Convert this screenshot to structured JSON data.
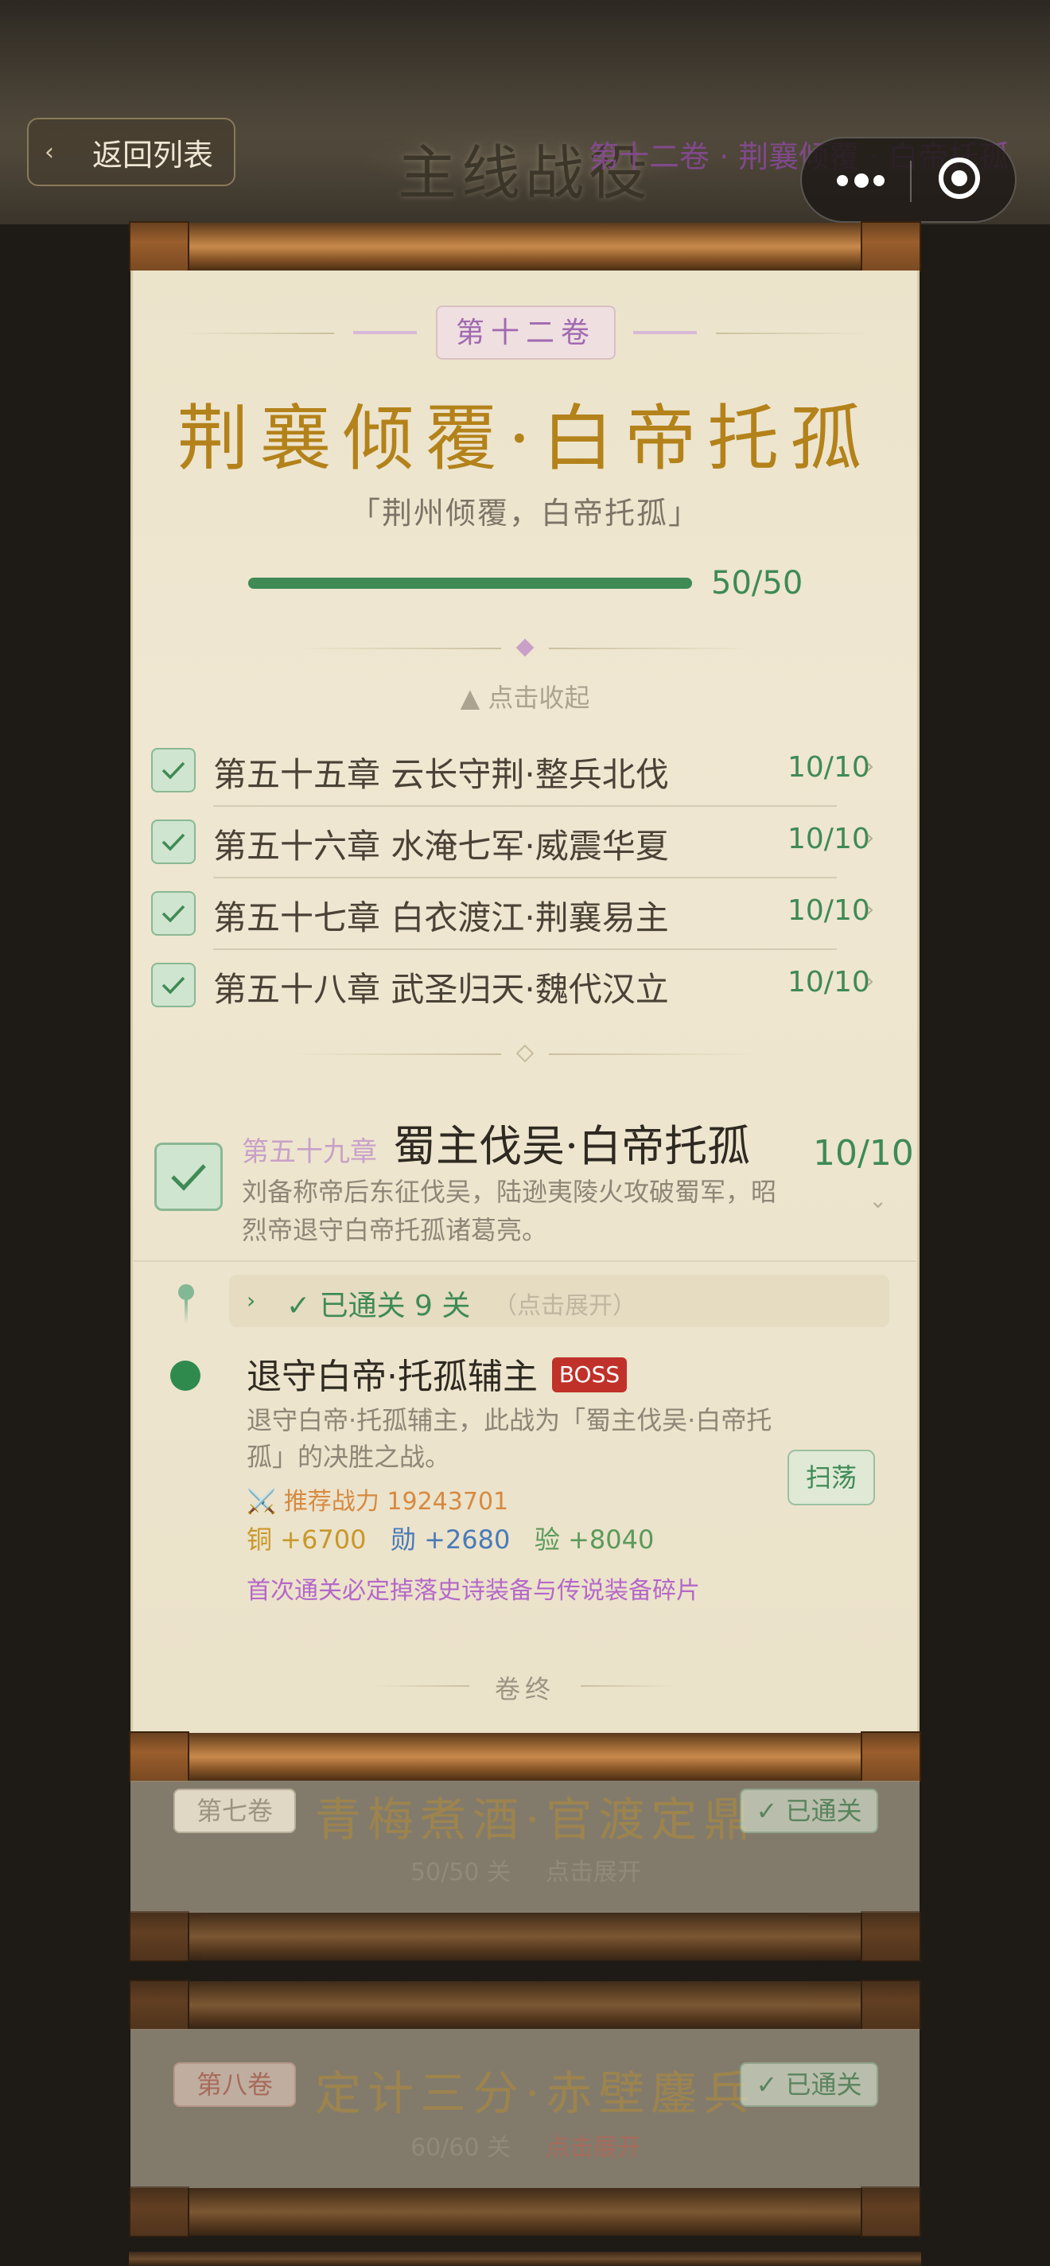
{
  "header": {
    "back_label": "返回列表",
    "back_icon": "chevron-left-icon",
    "title": "主线战役",
    "subtitle": "第十二卷 · 荆襄倾覆 · 白帝托孤"
  },
  "volume": {
    "tag": "第十二卷",
    "title": "荆襄倾覆·白帝托孤",
    "quote": "「荆州倾覆，白帝托孤」",
    "progress_text": "50/50",
    "progress_value": 1.0,
    "collapse_label": "▲ 点击收起"
  },
  "chapters": [
    {
      "name": "第五十五章 云长守荆·整兵北伐",
      "count": "10/10"
    },
    {
      "name": "第五十六章 水淹七军·威震华夏",
      "count": "10/10"
    },
    {
      "name": "第五十七章 白衣渡江·荆襄易主",
      "count": "10/10"
    },
    {
      "name": "第五十八章 武圣归天·魏代汉立",
      "count": "10/10"
    }
  ],
  "current_chapter": {
    "tag": "第五十九章",
    "name": "蜀主伐吴·白帝托孤",
    "count": "10/10",
    "desc": "刘备称帝后东征伐吴，陆逊夷陵火攻破蜀军，昭烈帝退守白帝托孤诸葛亮。",
    "cleared_text": "已通关 9 关",
    "cleared_hint": "（点击展开）"
  },
  "stage": {
    "name": "退守白帝·托孤辅主",
    "badge": "BOSS",
    "desc": "退守白帝·托孤辅主，此战为「蜀主伐吴·白帝托孤」的决胜之战。",
    "power": "推荐战力 19243701",
    "reward_copper": "铜 +6700",
    "reward_merit": "勋 +2680",
    "reward_exp": "验 +8040",
    "drop_note": "首次通关必定掉落史诗装备与传说装备碎片",
    "sweep_label": "扫荡"
  },
  "end_label": "卷终",
  "other_volumes": [
    {
      "tag": "第七卷",
      "title": "青梅煮酒·官渡定鼎",
      "pass": "已通关",
      "progress": "50/50 关",
      "expand": "点击展开"
    },
    {
      "tag": "第八卷",
      "title": "定计三分·赤壁鏖兵",
      "pass": "已通关",
      "progress": "60/60 关",
      "expand": "点击展开"
    }
  ],
  "colors": {
    "accent_green": "#3f8a55",
    "gold": "#b3821a",
    "boss_red": "#c0312a",
    "purple": "#a06ab0"
  }
}
